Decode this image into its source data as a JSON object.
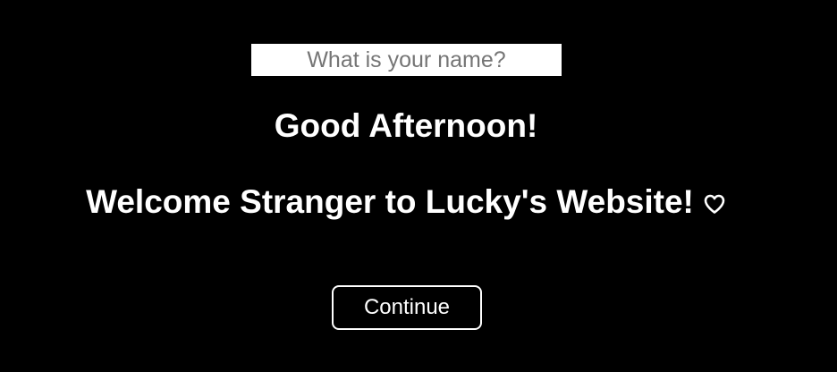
{
  "name_input": {
    "placeholder": "What is your name?",
    "value": ""
  },
  "greeting": "Good Afternoon!",
  "welcome": {
    "text": "Welcome Stranger to Lucky's Website!",
    "icon": "heart-outline-icon"
  },
  "continue_button": {
    "label": "Continue"
  },
  "colors": {
    "background": "#000000",
    "text": "#ffffff",
    "input_background": "#ffffff",
    "placeholder": "#757575"
  }
}
